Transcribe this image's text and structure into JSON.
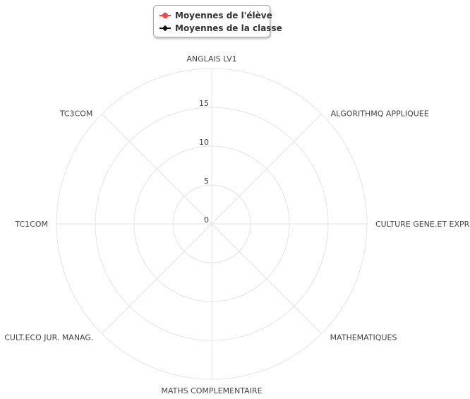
{
  "legend": {
    "student_label": "Moyennes de l'élève",
    "class_label": "Moyennes de la classe"
  },
  "colors": {
    "student": "#f2464a",
    "class": "#111111",
    "grid": "#e4e4e4"
  },
  "chart_data": {
    "type": "radar",
    "grid": true,
    "legend_position": "top-center",
    "categories": [
      "ANGLAIS LV1",
      "ALGORITHMQ APPLIQUEE",
      "CULTURE GENE.ET EXPR",
      "MATHEMATIQUES",
      "MATHS COMPLEMENTAIRE",
      "CULT.ECO JUR. MANAG.",
      "TC1COM",
      "TC3COM"
    ],
    "radial_ticks": [
      "0",
      "5",
      "10",
      "15"
    ],
    "rlim": [
      0,
      20
    ],
    "series": [
      {
        "name": "Moyennes de l'élève",
        "values": []
      },
      {
        "name": "Moyennes de la classe",
        "values": []
      }
    ]
  }
}
